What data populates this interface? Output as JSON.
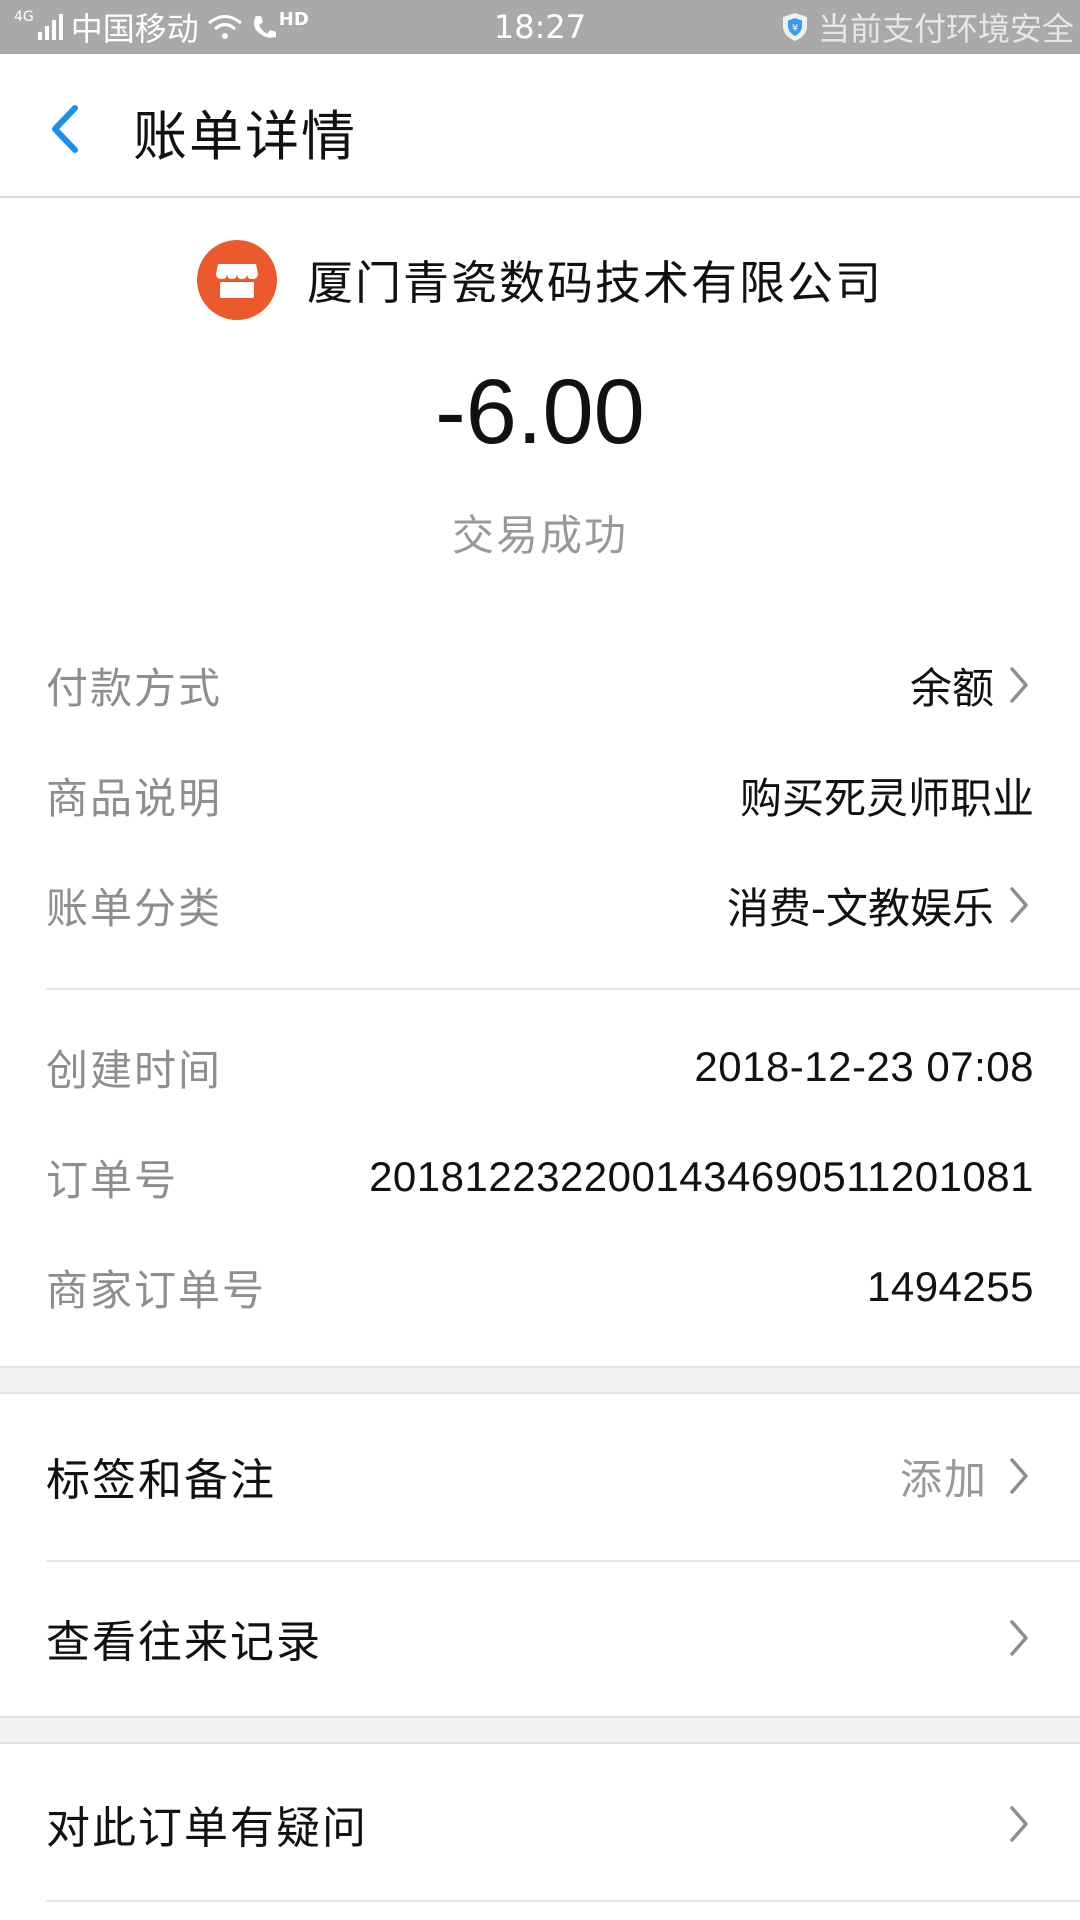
{
  "status_bar": {
    "network_type": "4G",
    "carrier": "中国移动",
    "hd_label": "HD",
    "time": "18:27",
    "security_text": "当前支付环境安全"
  },
  "header": {
    "title": "账单详情"
  },
  "transaction": {
    "merchant_name": "厦门青瓷数码技术有限公司",
    "amount": "-6.00",
    "status": "交易成功"
  },
  "details": {
    "payment_method": {
      "label": "付款方式",
      "value": "余额"
    },
    "product_desc": {
      "label": "商品说明",
      "value": "购买死灵师职业"
    },
    "bill_category": {
      "label": "账单分类",
      "value": "消费-文教娱乐"
    },
    "created_time": {
      "label": "创建时间",
      "value": "2018-12-23 07:08"
    },
    "order_no": {
      "label": "订单号",
      "value": "2018122322001434690511201081"
    },
    "merchant_order_no": {
      "label": "商家订单号",
      "value": "1494255"
    }
  },
  "actions": {
    "tags_notes": {
      "label": "标签和备注",
      "hint": "添加"
    },
    "history": {
      "label": "查看往来记录"
    },
    "question": {
      "label": "对此订单有疑问"
    }
  },
  "colors": {
    "accent_blue": "#1a8ff0",
    "merchant_orange": "#ea5a2c",
    "status_bar_gray": "#a9a9a9"
  }
}
